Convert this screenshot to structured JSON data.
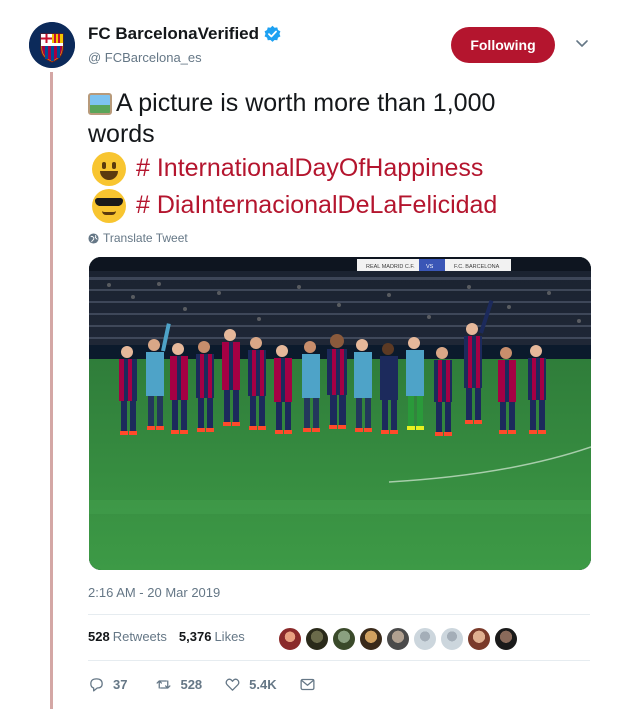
{
  "author": {
    "display_name": "FC Barcelona",
    "verified_text": "Verified",
    "handle": "@ FCBarcelona_es"
  },
  "follow_button": {
    "label": "Following"
  },
  "tweet": {
    "line1": "A picture is worth more than 1,000",
    "line2": "words",
    "hashtag1": "# InternationalDayOfHappiness",
    "hashtag2": "# DiaInternacionalDeLaFelicidad"
  },
  "translate": {
    "label": "Translate Tweet"
  },
  "photo": {
    "banner_left": "REAL MADRID C.F.",
    "banner_mid": "VS",
    "banner_right": "F.C. BARCELONA"
  },
  "timestamp": "2:16 AM - 20 Mar 2019",
  "stats": {
    "retweets_count": "528",
    "retweets_label": "Retweets",
    "likes_count": "5,376",
    "likes_label": "Likes"
  },
  "actions": {
    "replies": "37",
    "retweets": "528",
    "likes": "5.4K"
  },
  "colors": {
    "brand": "#b4152e",
    "text": "#14171a",
    "muted": "#657786",
    "thread_line": "#d4a7a5"
  },
  "icons": [
    "verified-icon",
    "chevron-down-icon",
    "globe-icon",
    "reply-icon",
    "retweet-icon",
    "like-icon",
    "message-icon"
  ]
}
